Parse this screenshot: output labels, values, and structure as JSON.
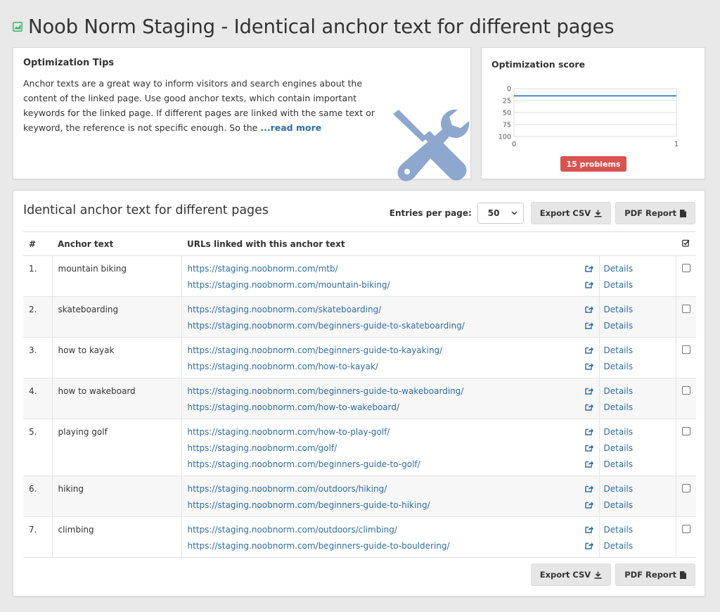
{
  "header": {
    "title": "Noob Norm Staging - Identical anchor text for different pages",
    "icon": "area-chart-icon",
    "icon_color": "#3cb371"
  },
  "tips": {
    "title": "Optimization Tips",
    "text": "Anchor texts are a great way to inform visitors and search engines about the content of the linked page. Use good anchor texts, which contain important keywords for the linked page. If different pages are linked with the same text or keyword, the reference is not specific enough. So the ",
    "read_more": "...read more",
    "icon": "tools-icon",
    "icon_color": "#8ea7cf"
  },
  "score": {
    "title": "Optimization score",
    "badge": "15 problems",
    "badge_color": "#d9534f",
    "chart_data": {
      "type": "line",
      "x": [
        0,
        1
      ],
      "xticks": [
        "0",
        "1"
      ],
      "yticks": [
        "0",
        "25",
        "50",
        "75",
        "100"
      ],
      "ylim": [
        0,
        100
      ],
      "y_inverted": true,
      "series": [
        {
          "values": [
            15,
            15
          ],
          "color": "#4a86c5"
        }
      ]
    }
  },
  "main": {
    "title": "Identical anchor text for different pages",
    "entries_label": "Entries per page:",
    "entries_value": "50",
    "export_csv": "Export CSV",
    "pdf_report": "PDF Report",
    "columns": [
      "#",
      "Anchor text",
      "URLs linked with this anchor text"
    ],
    "details_label": "Details",
    "rows": [
      {
        "num": "1.",
        "anchor": "mountain biking",
        "urls": [
          "https://staging.noobnorm.com/mtb/",
          "https://staging.noobnorm.com/mountain-biking/"
        ]
      },
      {
        "num": "2.",
        "anchor": "skateboarding",
        "urls": [
          "https://staging.noobnorm.com/skateboarding/",
          "https://staging.noobnorm.com/beginners-guide-to-skateboarding/"
        ]
      },
      {
        "num": "3.",
        "anchor": "how to kayak",
        "urls": [
          "https://staging.noobnorm.com/beginners-guide-to-kayaking/",
          "https://staging.noobnorm.com/how-to-kayak/"
        ]
      },
      {
        "num": "4.",
        "anchor": "how to wakeboard",
        "urls": [
          "https://staging.noobnorm.com/beginners-guide-to-wakeboarding/",
          "https://staging.noobnorm.com/how-to-wakeboard/"
        ]
      },
      {
        "num": "5.",
        "anchor": "playing golf",
        "urls": [
          "https://staging.noobnorm.com/how-to-play-golf/",
          "https://staging.noobnorm.com/golf/",
          "https://staging.noobnorm.com/beginners-guide-to-golf/"
        ]
      },
      {
        "num": "6.",
        "anchor": "hiking",
        "urls": [
          "https://staging.noobnorm.com/outdoors/hiking/",
          "https://staging.noobnorm.com/beginners-guide-to-hiking/"
        ]
      },
      {
        "num": "7.",
        "anchor": "climbing",
        "urls": [
          "https://staging.noobnorm.com/outdoors/climbing/",
          "https://staging.noobnorm.com/beginners-guide-to-bouldering/"
        ]
      }
    ]
  }
}
